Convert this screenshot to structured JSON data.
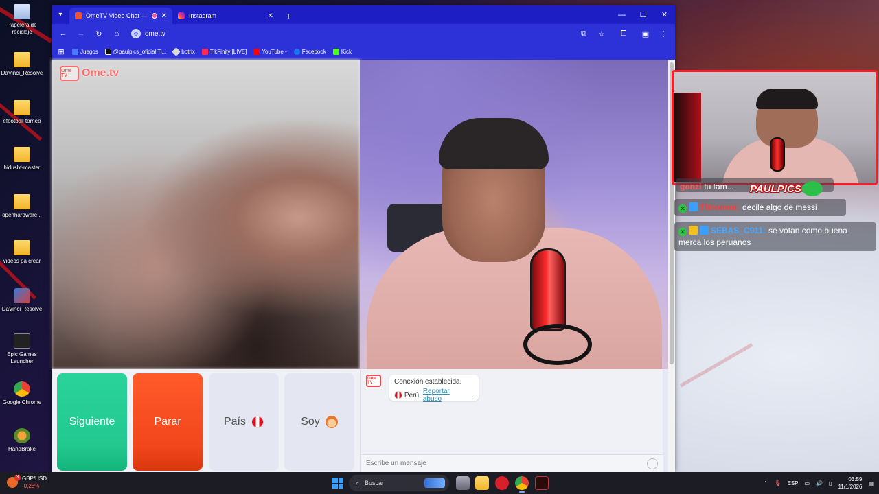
{
  "desktop": {
    "icons": [
      {
        "label": "Papelera de reciclaje",
        "icon": "recycle-bin-icon"
      },
      {
        "label": "DaVinci_Resolve",
        "icon": "folder-icon"
      },
      {
        "label": "efootball torneo",
        "icon": "folder-icon"
      },
      {
        "label": "hidusbf-master",
        "icon": "folder-icon"
      },
      {
        "label": "openhardware...",
        "icon": "folder-icon"
      },
      {
        "label": "videos pa crear",
        "icon": "folder-icon"
      },
      {
        "label": "DaVinci Resolve",
        "icon": "davinci-icon"
      },
      {
        "label": "Epic Games Launcher",
        "icon": "epic-games-icon"
      },
      {
        "label": "Google Chrome",
        "icon": "chrome-icon"
      },
      {
        "label": "HandBrake",
        "icon": "handbrake-icon"
      }
    ]
  },
  "browser": {
    "tabs": [
      {
        "title": "OmeTV Video Chat — Ome",
        "icon": "ometv-icon",
        "active": true
      },
      {
        "title": "Instagram",
        "icon": "instagram-icon",
        "active": false
      }
    ],
    "address": "ome.tv",
    "bookmarks": [
      {
        "label": "Juegos",
        "color": "#4a7cff"
      },
      {
        "label": "@paulpics_oficial Ti...",
        "color": "#111111"
      },
      {
        "label": "botrix",
        "color": "#dddddd"
      },
      {
        "label": "TikFinity [LIVE]",
        "color": "#ff2a5a"
      },
      {
        "label": "YouTube -",
        "color": "#ff0000"
      },
      {
        "label": "Facebook",
        "color": "#1877f2"
      },
      {
        "label": "Kick",
        "color": "#53fc18"
      }
    ]
  },
  "ometv": {
    "logo_text": "Ome.tv",
    "logo_badge": "Ome TV",
    "buttons": {
      "next": "Siguiente",
      "stop": "Parar",
      "country": "País",
      "me": "Soy"
    },
    "system_message": {
      "line1": "Conexión establecida.",
      "country": "Perú.",
      "report": "Reportar abuso",
      "report_suffix": "."
    },
    "input_placeholder": "Escribe un mensaje"
  },
  "overlay": {
    "streamer_tag": "PAULPICS",
    "chat": [
      {
        "user": "gonzi",
        "text": "tu tam...",
        "user_color": "#ff5a5a"
      },
      {
        "user": "Thhommi:",
        "text": "decile algo de messi",
        "user_color": "#ff3a3a"
      },
      {
        "user": "SEBAS_C911:",
        "text": "se votan como buena merca los peruanos",
        "user_color": "#4aa8ff"
      }
    ]
  },
  "taskbar": {
    "ticker_label": "GBP/USD",
    "ticker_change": "-0,28%",
    "ticker_badge": "3",
    "search_placeholder": "Buscar",
    "language": "ESP",
    "time": "03:59",
    "date": "11/1/2026"
  },
  "colors": {
    "browser_frame": "#1d1fc4",
    "next_button": "#22c88f",
    "stop_button": "#f2461c",
    "overlay_border": "#ff1a2a"
  }
}
